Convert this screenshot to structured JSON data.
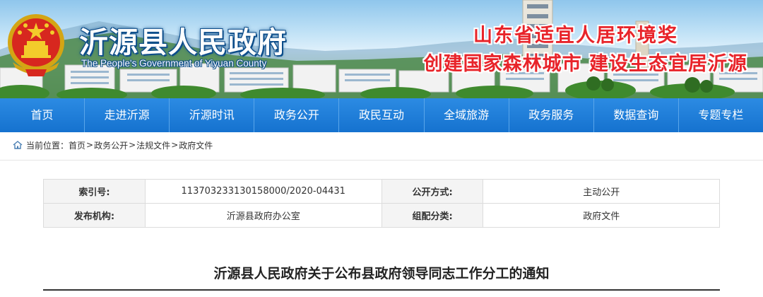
{
  "header": {
    "site_title": "沂源县人民政府",
    "site_subtitle": "The People's Government of Yiyuan County",
    "slogan_line1": "山东省适宜人居环境奖",
    "slogan_line2": "创建国家森林城市 建设生态宜居沂源"
  },
  "nav": {
    "items": [
      {
        "label": "首页"
      },
      {
        "label": "走进沂源"
      },
      {
        "label": "沂源时讯"
      },
      {
        "label": "政务公开"
      },
      {
        "label": "政民互动"
      },
      {
        "label": "全域旅游"
      },
      {
        "label": "政务服务"
      },
      {
        "label": "数据查询"
      },
      {
        "label": "专题专栏"
      }
    ]
  },
  "breadcrumb": {
    "prefix": "当前位置：",
    "items": [
      "首页",
      "政务公开",
      "法规文件",
      "政府文件"
    ],
    "separator": ">"
  },
  "meta": {
    "index_label": "索引号:",
    "index_value": "113703233130158000/2020-04431",
    "publish_mode_label": "公开方式:",
    "publish_mode_value": "主动公开",
    "issuer_label": "发布机构:",
    "issuer_value": "沂源县政府办公室",
    "category_label": "组配分类:",
    "category_value": "政府文件"
  },
  "document": {
    "title": "沂源县人民政府关于公布县政府领导同志工作分工的通知"
  },
  "colors": {
    "nav_blue": "#1a78d6",
    "slogan_red": "#e8242a",
    "title_outline": "#0d4d8a"
  },
  "icons": {
    "emblem": "national-emblem",
    "breadcrumb": "home-icon"
  }
}
